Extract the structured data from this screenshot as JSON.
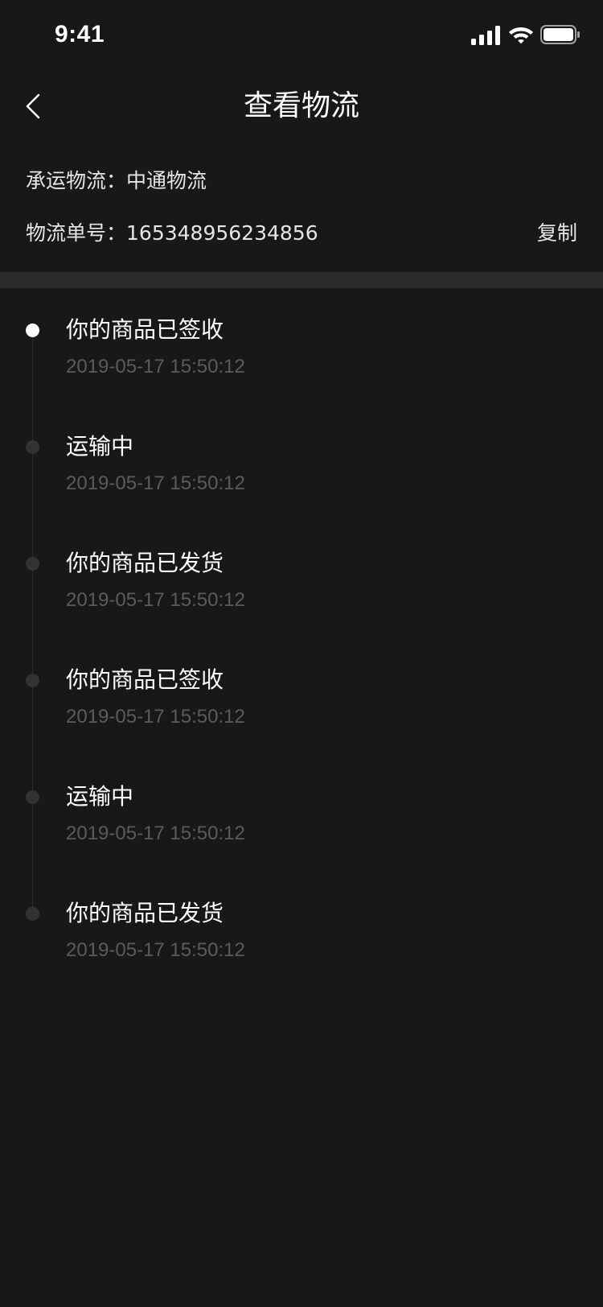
{
  "status_bar": {
    "time": "9:41"
  },
  "nav": {
    "title": "查看物流"
  },
  "shipping": {
    "carrier_label": "承运物流：",
    "carrier_value": "中通物流",
    "tracking_label": "物流单号：",
    "tracking_value": "165348956234856",
    "copy_label": "复制"
  },
  "timeline": [
    {
      "title": "你的商品已签收",
      "time": "2019-05-17 15:50:12",
      "active": true
    },
    {
      "title": "运输中",
      "time": "2019-05-17 15:50:12",
      "active": false
    },
    {
      "title": "你的商品已发货",
      "time": "2019-05-17 15:50:12",
      "active": false
    },
    {
      "title": "你的商品已签收",
      "time": "2019-05-17 15:50:12",
      "active": false
    },
    {
      "title": "运输中",
      "time": "2019-05-17 15:50:12",
      "active": false
    },
    {
      "title": "你的商品已发货",
      "time": "2019-05-17 15:50:12",
      "active": false
    }
  ],
  "icons": {
    "back": "chevron-left-icon",
    "signal": "cellular-signal-icon",
    "wifi": "wifi-icon",
    "battery": "battery-icon"
  },
  "colors": {
    "background": "#191818",
    "divider": "#2d2b2c",
    "active_dot": "#ffffff",
    "inactive_dot": "#333132",
    "time_text": "#5c5a5b"
  }
}
